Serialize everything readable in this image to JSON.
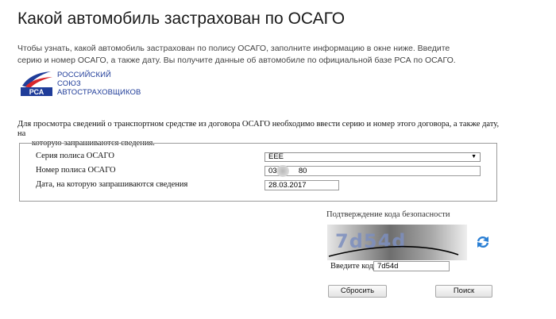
{
  "header": {
    "title": "Какой автомобиль застрахован по ОСАГО"
  },
  "intro": {
    "line1": "Чтобы узнать, какой автомобиль застрахован по полису ОСАГО, заполните информацию в окне ниже. Введите",
    "line2": "серию и номер ОСАГО, а также дату. Вы получите данные об автомобиле по официальной базе РСА по ОСАГО."
  },
  "logo": {
    "emblem_text": "РСА",
    "line1": "РОССИЙСКИЙ",
    "line2": "СОЮЗ",
    "line3": "АВТОСТРАХОВЩИКОВ",
    "colors": {
      "blue": "#1f3c99",
      "red": "#d8262c"
    }
  },
  "form": {
    "note_line1": "Для просмотра сведений о транспортном средстве из договора ОСАГО необходимо ввести серию и номер этого договора, а также дату, на",
    "note_line2": "которую запрашиваются сведения.",
    "series_label": "Серия полиса ОСАГО",
    "series_value": "ЕЕЕ",
    "number_label": "Номер полиса ОСАГО",
    "number_prefix": "033",
    "number_suffix": "80",
    "date_label": "Дата, на которую запрашиваются сведения",
    "date_value": "28.03.2017"
  },
  "captcha": {
    "title": "Подтверждение кода безопасности",
    "image_text": "7d54d",
    "refresh_icon": "refresh-icon",
    "code_label": "Введите код:",
    "code_value": "7d54d"
  },
  "buttons": {
    "reset_label": "Сбросить",
    "search_label": "Поиск"
  }
}
